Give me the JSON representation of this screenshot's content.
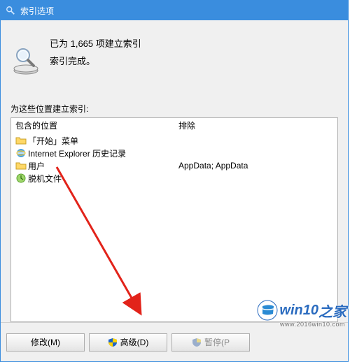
{
  "title": "索引选项",
  "status": {
    "line1": "已为 1,665 项建立索引",
    "line2": "索引完成。"
  },
  "section_label": "为这些位置建立索引:",
  "columns": {
    "left_header": "包含的位置",
    "right_header": "排除"
  },
  "included": [
    {
      "icon": "folder",
      "label": "「开始」菜单",
      "exclude": ""
    },
    {
      "icon": "ie",
      "label": "Internet Explorer 历史记录",
      "exclude": ""
    },
    {
      "icon": "folder",
      "label": "用户",
      "exclude": "AppData; AppData"
    },
    {
      "icon": "offline",
      "label": "脱机文件",
      "exclude": ""
    }
  ],
  "buttons": {
    "modify": "修改(M)",
    "advanced": "高级(D)",
    "pause": "暂停(P"
  },
  "watermark": {
    "brand": "win10",
    "suffix": "之家",
    "url": "www.2016win10.com"
  }
}
